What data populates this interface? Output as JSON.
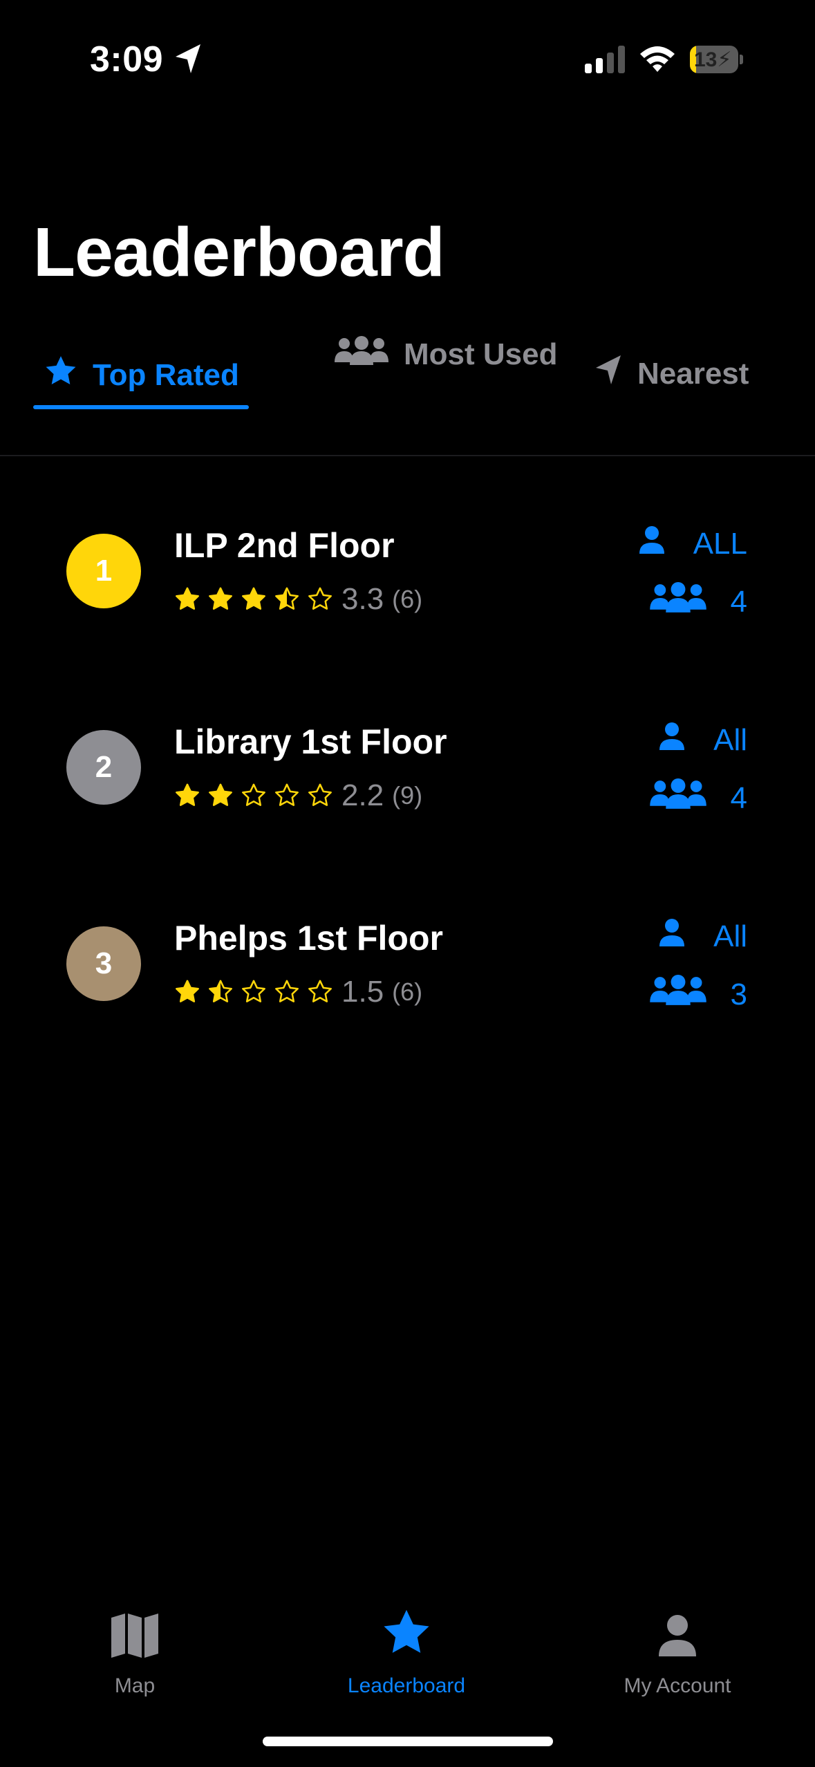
{
  "status_bar": {
    "time": "3:09",
    "battery_level": "13",
    "battery_fraction": 0.13,
    "icons": [
      "location-arrow-icon",
      "cellular-signal-icon",
      "wifi-icon",
      "battery-charging-icon"
    ]
  },
  "page": {
    "title": "Leaderboard"
  },
  "tabs": [
    {
      "label": "Top Rated",
      "icon": "star-icon",
      "active": true
    },
    {
      "label": "Most Used",
      "icon": "people-icon",
      "active": false
    },
    {
      "label": "Nearest",
      "icon": "location-arrow-icon",
      "active": false
    }
  ],
  "leaderboard": [
    {
      "rank": "1",
      "name": "ILP 2nd Floor",
      "rating": "3.3",
      "rating_value": 3.3,
      "count": "(6)",
      "access": "ALL",
      "capacity": "4",
      "badge_color": "#ffd60a"
    },
    {
      "rank": "2",
      "name": "Library 1st Floor",
      "rating": "2.2",
      "rating_value": 2.2,
      "count": "(9)",
      "access": "All",
      "capacity": "4",
      "badge_color": "#8e8e93"
    },
    {
      "rank": "3",
      "name": "Phelps 1st Floor",
      "rating": "1.5",
      "rating_value": 1.5,
      "count": "(6)",
      "access": "All",
      "capacity": "3",
      "badge_color": "#a89070"
    }
  ],
  "bottom_nav": [
    {
      "label": "Map",
      "icon": "map-icon",
      "active": false
    },
    {
      "label": "Leaderboard",
      "icon": "star-icon",
      "active": true
    },
    {
      "label": "My Account",
      "icon": "person-icon",
      "active": false
    }
  ],
  "colors": {
    "accent": "#0a84ff",
    "star": "#ffd60a",
    "muted": "#8e8e93",
    "background": "#000000"
  }
}
